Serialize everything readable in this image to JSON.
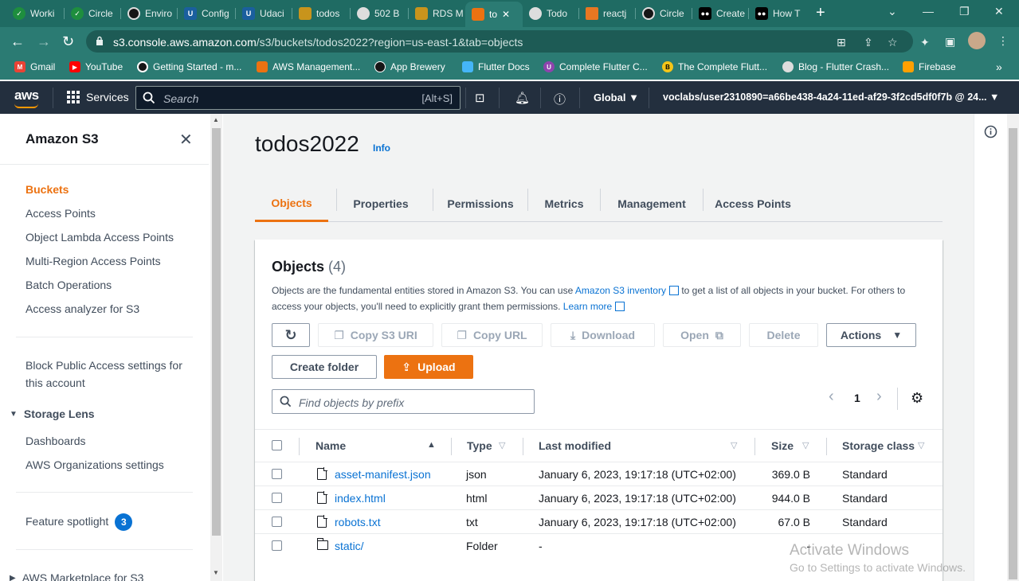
{
  "browser": {
    "tabs": [
      {
        "label": "Worki",
        "color": "#1e8e3e"
      },
      {
        "label": "Circle",
        "color": "#1e8e3e"
      },
      {
        "label": "Enviro",
        "color": "#161616"
      },
      {
        "label": "Config",
        "color": "#1a5f9e"
      },
      {
        "label": "Udaci",
        "color": "#1a5f9e"
      },
      {
        "label": "todos",
        "color": "#c8941c"
      },
      {
        "label": "502 B",
        "color": "#444444"
      },
      {
        "label": "RDS M",
        "color": "#c8941c"
      },
      {
        "label": "to",
        "color": "#ec7211",
        "active": true
      },
      {
        "label": "Todo",
        "color": "#444444"
      },
      {
        "label": "reactj",
        "color": "#e87722"
      },
      {
        "label": "Circle",
        "color": "#161616"
      },
      {
        "label": "Create",
        "color": "#000000"
      },
      {
        "label": "How T",
        "color": "#000000"
      }
    ],
    "url_host": "s3.console.aws.amazon.com",
    "url_path": "/s3/buckets/todos2022?region=us-east-1&tab=objects",
    "bookmarks": [
      {
        "label": "Gmail",
        "color": "#ea4335"
      },
      {
        "label": "YouTube",
        "color": "#ff0000"
      },
      {
        "label": "Getting Started - m...",
        "color": "#161616"
      },
      {
        "label": "AWS Management...",
        "color": "#ec7211"
      },
      {
        "label": "App Brewery",
        "color": "#161616"
      },
      {
        "label": "Flutter Docs",
        "color": "#45b6f8"
      },
      {
        "label": "Complete Flutter C...",
        "color": "#8e44ad"
      },
      {
        "label": "The Complete Flutt...",
        "color": "#f5c518"
      },
      {
        "label": "Blog - Flutter Crash...",
        "color": "#dddddd"
      },
      {
        "label": "Firebase",
        "color": "#ffa000"
      }
    ]
  },
  "aws_nav": {
    "logo": "aws",
    "services_label": "Services",
    "search_placeholder": "Search",
    "search_shortcut": "[Alt+S]",
    "region": "Global",
    "account": "voclabs/user2310890=a66be438-4a24-11ed-af29-3f2cd5df0f7b @ 24..."
  },
  "sidenav": {
    "title": "Amazon S3",
    "items": [
      "Buckets",
      "Access Points",
      "Object Lambda Access Points",
      "Multi-Region Access Points",
      "Batch Operations",
      "Access analyzer for S3"
    ],
    "block_public_line1": "Block Public Access settings for",
    "block_public_line2": "this account",
    "storage_lens_label": "Storage Lens",
    "storage_lens_items": [
      "Dashboards",
      "AWS Organizations settings"
    ],
    "feature_spotlight": "Feature spotlight",
    "feature_count": "3",
    "marketplace": "AWS Marketplace for S3"
  },
  "main": {
    "bucket_name": "todos2022",
    "info": "Info",
    "tabs": [
      "Objects",
      "Properties",
      "Permissions",
      "Metrics",
      "Management",
      "Access Points"
    ],
    "objects_title": "Objects",
    "objects_count": "(4)",
    "desc_part1": "Objects are the fundamental entities stored in Amazon S3. You can use ",
    "desc_link1": "Amazon S3 inventory",
    "desc_part2": " to get a list of all objects in your bucket. For others to access your objects, you'll need to explicitly grant them permissions. ",
    "desc_link2": "Learn more",
    "buttons": {
      "copy_uri": "Copy S3 URI",
      "copy_url": "Copy URL",
      "download": "Download",
      "open": "Open",
      "delete": "Delete",
      "actions": "Actions",
      "create_folder": "Create folder",
      "upload": "Upload"
    },
    "filter_placeholder": "Find objects by prefix",
    "page": "1",
    "columns": [
      "Name",
      "Type",
      "Last modified",
      "Size",
      "Storage class"
    ],
    "rows": [
      {
        "name": "asset-manifest.json",
        "type": "json",
        "modified": "January 6, 2023, 19:17:18 (UTC+02:00)",
        "size": "369.0 B",
        "class": "Standard",
        "kind": "file"
      },
      {
        "name": "index.html",
        "type": "html",
        "modified": "January 6, 2023, 19:17:18 (UTC+02:00)",
        "size": "944.0 B",
        "class": "Standard",
        "kind": "file"
      },
      {
        "name": "robots.txt",
        "type": "txt",
        "modified": "January 6, 2023, 19:17:18 (UTC+02:00)",
        "size": "67.0 B",
        "class": "Standard",
        "kind": "file"
      },
      {
        "name": "static/",
        "type": "Folder",
        "modified": "-",
        "size": "-",
        "class": "",
        "kind": "folder"
      }
    ]
  },
  "watermark": {
    "line1": "Activate Windows",
    "line2": "Go to Settings to activate Windows."
  }
}
